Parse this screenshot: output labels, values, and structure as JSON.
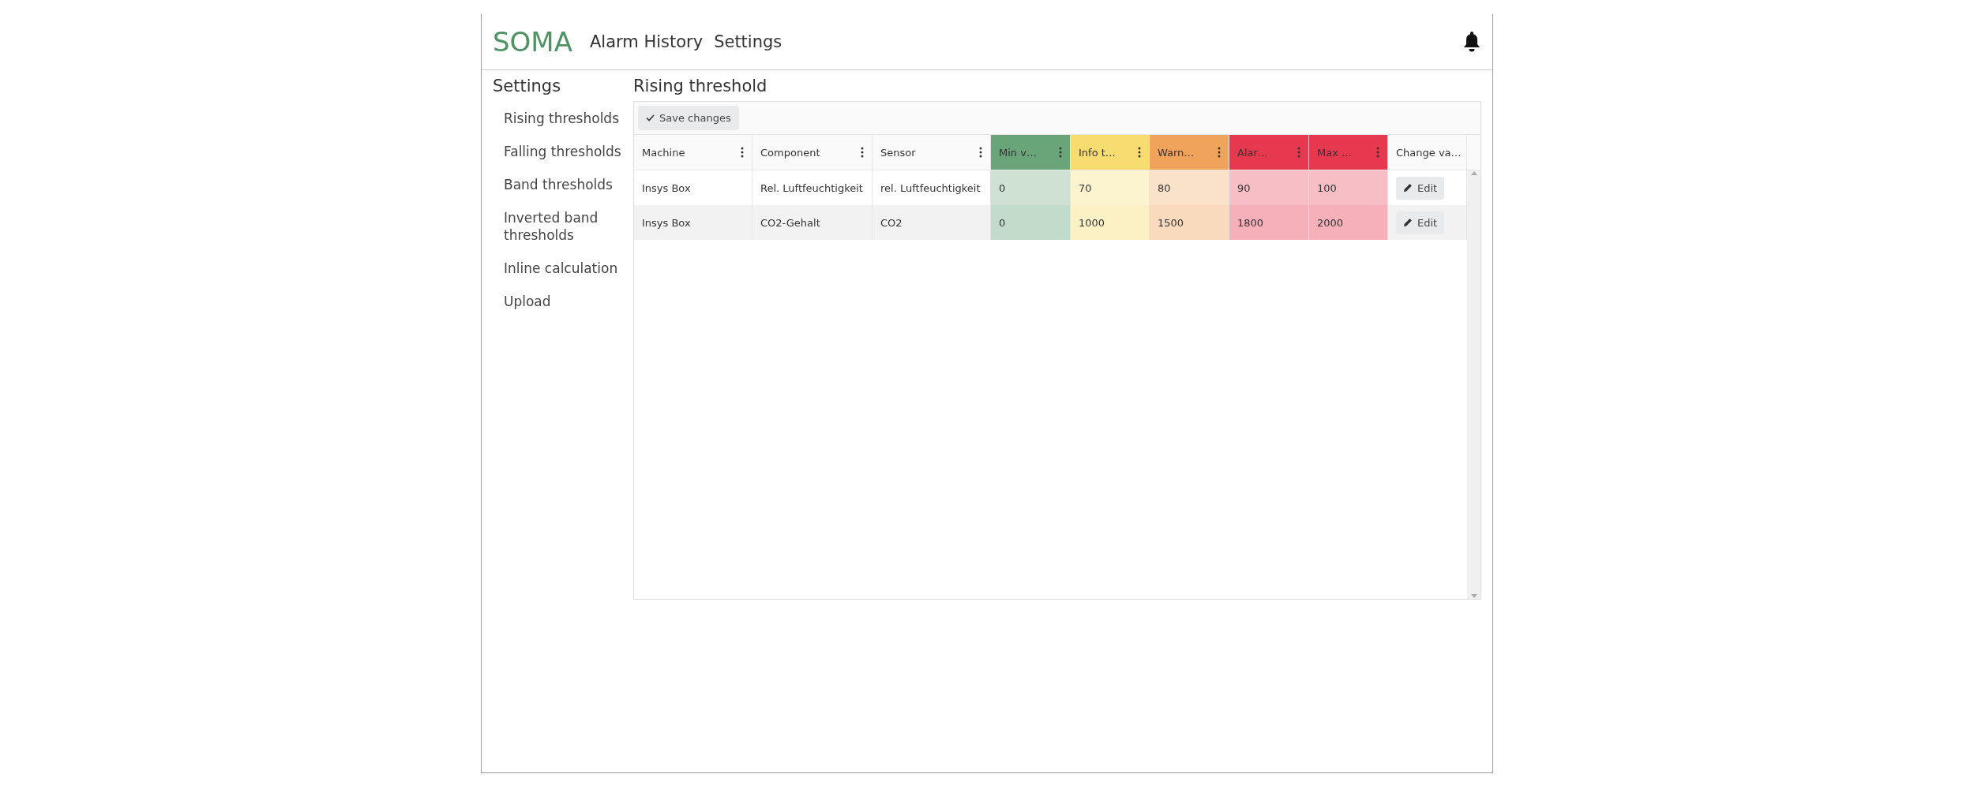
{
  "header": {
    "logo": "SOMA",
    "nav": [
      {
        "label": "Alarm History"
      },
      {
        "label": "Settings"
      }
    ]
  },
  "sidebar": {
    "title": "Settings",
    "items": [
      {
        "label": "Rising thresholds"
      },
      {
        "label": "Falling thresholds"
      },
      {
        "label": "Band thresholds"
      },
      {
        "label": "Inverted band thresholds"
      },
      {
        "label": "Inline calculation"
      },
      {
        "label": "Upload"
      }
    ]
  },
  "content": {
    "title": "Rising threshold",
    "toolbar": {
      "save_button": "Save changes"
    },
    "table": {
      "columns": [
        {
          "label": "Machine",
          "menu": true
        },
        {
          "label": "Component",
          "menu": true
        },
        {
          "label": "Sensor",
          "menu": true
        },
        {
          "label": "Min v…",
          "menu": true,
          "color": "#6aa57a"
        },
        {
          "label": "Info t…",
          "menu": true,
          "color": "#f7dc6f"
        },
        {
          "label": "Warn…",
          "menu": true,
          "color": "#f0a35a"
        },
        {
          "label": "Alar…",
          "menu": true,
          "color": "#e63950"
        },
        {
          "label": "Max …",
          "menu": true,
          "color": "#e63950"
        },
        {
          "label": "Change va…"
        }
      ],
      "rows": [
        {
          "cells": [
            "Insys Box",
            "Rel. Luftfeuchtigkeit",
            "rel. Luftfeuchtigkeit",
            "0",
            "70",
            "80",
            "90",
            "100"
          ],
          "action": "Edit"
        },
        {
          "cells": [
            "Insys Box",
            "CO2-Gehalt",
            "CO2",
            "0",
            "1000",
            "1500",
            "1800",
            "2000"
          ],
          "action": "Edit"
        }
      ]
    }
  }
}
